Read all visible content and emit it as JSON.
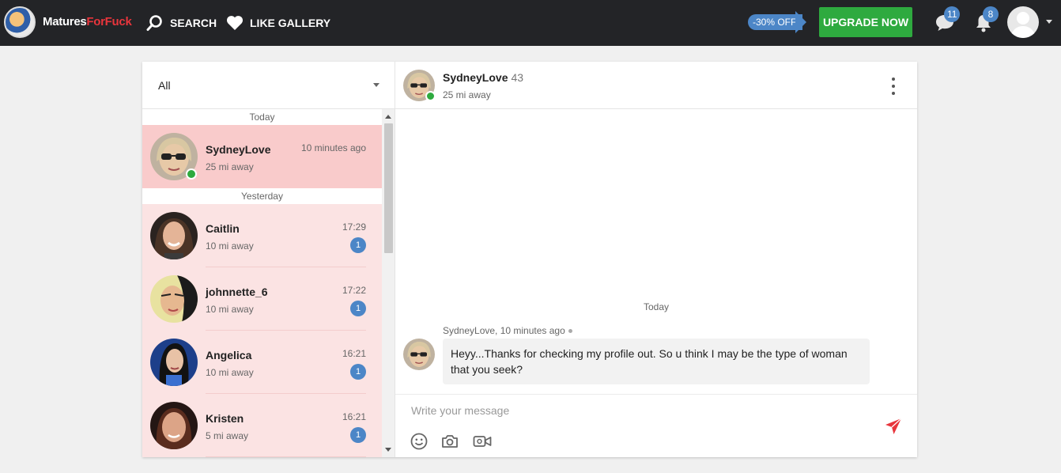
{
  "brand": {
    "part1": "Matures",
    "part2": "ForFuck"
  },
  "nav": {
    "search_label": "SEARCH",
    "like_gallery_label": "LIKE GALLERY"
  },
  "promo": {
    "discount_label": "-30% OFF",
    "upgrade_label": "UPGRADE NOW"
  },
  "notifications": {
    "messages_count": "11",
    "alerts_count": "8"
  },
  "filter": {
    "selected": "All"
  },
  "conversations": {
    "today_label": "Today",
    "yesterday_label": "Yesterday",
    "items": [
      {
        "name": "SydneyLove",
        "distance": "25 mi away",
        "time": "10 minutes ago",
        "unread": "",
        "online": true,
        "active": true
      },
      {
        "name": "Caitlin",
        "distance": "10 mi away",
        "time": "17:29",
        "unread": "1",
        "online": false,
        "active": false
      },
      {
        "name": "johnnette_6",
        "distance": "10 mi away",
        "time": "17:22",
        "unread": "1",
        "online": false,
        "active": false
      },
      {
        "name": "Angelica",
        "distance": "10 mi away",
        "time": "16:21",
        "unread": "1",
        "online": false,
        "active": false
      },
      {
        "name": "Kristen",
        "distance": "5 mi away",
        "time": "16:21",
        "unread": "1",
        "online": false,
        "active": false
      }
    ]
  },
  "chat": {
    "name": "SydneyLove",
    "age": "43",
    "distance": "25 mi away",
    "day_label": "Today",
    "message_meta": "SydneyLove, 10 minutes ago",
    "message_text": "Heyy...Thanks for checking my profile out. So u think I may be the type of woman that you seek?",
    "input_placeholder": "Write your message"
  },
  "colors": {
    "topbar": "#232427",
    "brand_accent": "#e8353c",
    "upgrade_green": "#2eaa3f",
    "badge_blue": "#4c86c7",
    "active_row": "#f9cbcb",
    "row": "#fbe3e3",
    "send_red": "#e8353c"
  },
  "icons": {
    "search": "search-icon",
    "heart": "heart-icon",
    "messages": "chat-bubble-icon",
    "alerts": "bell-icon",
    "more": "more-vertical-icon",
    "emoji": "smiley-icon",
    "camera": "camera-icon",
    "video": "video-camera-icon",
    "send": "send-icon"
  }
}
